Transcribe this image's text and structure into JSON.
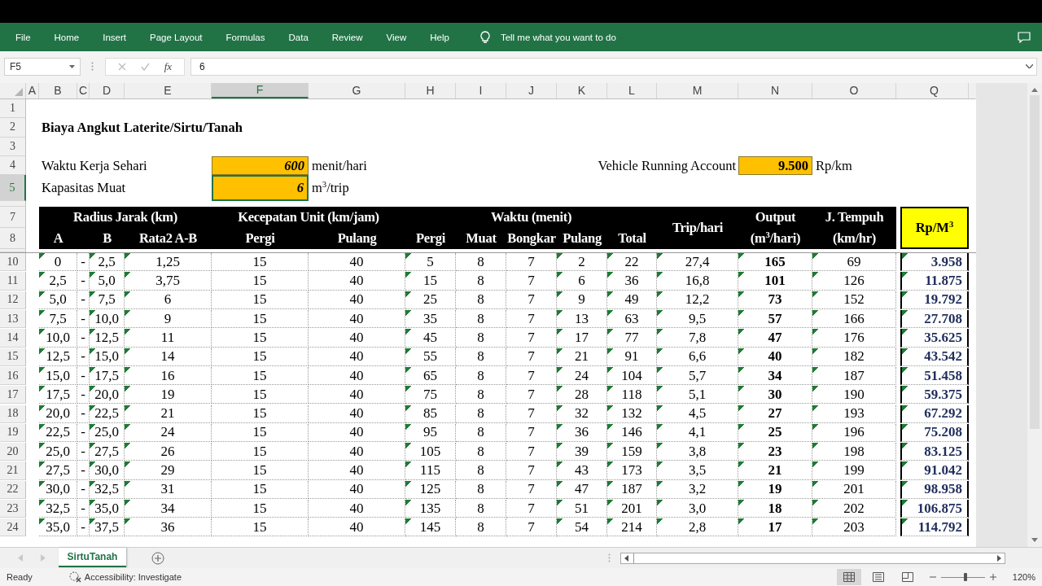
{
  "ribbon": {
    "tabs": [
      {
        "label": "File",
        "selected": false
      },
      {
        "label": "Home",
        "selected": false
      },
      {
        "label": "Insert",
        "selected": false
      },
      {
        "label": "Page Layout",
        "selected": false
      },
      {
        "label": "Formulas",
        "selected": false
      },
      {
        "label": "Data",
        "selected": false
      },
      {
        "label": "Review",
        "selected": false
      },
      {
        "label": "View",
        "selected": false
      },
      {
        "label": "Help",
        "selected": false
      }
    ],
    "tell_me": "Tell me what you want to do"
  },
  "formula_bar": {
    "name_box": "F5",
    "function_label": "fx",
    "formula": "6"
  },
  "column_headers": [
    {
      "label": "A",
      "selected": false
    },
    {
      "label": "B",
      "selected": false
    },
    {
      "label": "C",
      "selected": false
    },
    {
      "label": "D",
      "selected": false
    },
    {
      "label": "E",
      "selected": false
    },
    {
      "label": "F",
      "selected": true
    },
    {
      "label": "G",
      "selected": false
    },
    {
      "label": "H",
      "selected": false
    },
    {
      "label": "I",
      "selected": false
    },
    {
      "label": "J",
      "selected": false
    },
    {
      "label": "K",
      "selected": false
    },
    {
      "label": "L",
      "selected": false
    },
    {
      "label": "M",
      "selected": false
    },
    {
      "label": "N",
      "selected": false
    },
    {
      "label": "O",
      "selected": false
    },
    {
      "label": "Q",
      "selected": false
    }
  ],
  "top_row_numbers": [
    {
      "label": "1",
      "selected": false
    },
    {
      "label": "2",
      "selected": false
    },
    {
      "label": "3",
      "selected": false
    },
    {
      "label": "4",
      "selected": false
    },
    {
      "label": "5",
      "selected": true
    },
    {
      "label": "7",
      "selected": false
    },
    {
      "label": "8",
      "selected": false
    }
  ],
  "sheet": {
    "title": "Biaya Angkut Laterite/Sirtu/Tanah",
    "inputs": [
      {
        "label": "Waktu Kerja Sehari",
        "value": "600",
        "unit": "menit/hari",
        "selected": false
      },
      {
        "label": "Kapasitas Muat",
        "value": "6",
        "unit": "m$^{3}$/trip",
        "selected": true
      }
    ],
    "vehicle": {
      "label": "Vehicle Running Account",
      "value": "9.500",
      "unit": "Rp/km"
    },
    "header_row_1": [
      "Radius Jarak (km)",
      "Kecepatan Unit (km/jam)",
      "Waktu (menit)",
      "Trip/hari",
      "Output (m$^{3}$/hari)",
      "J. Tempuh (km/hr)"
    ],
    "header_row_2": [
      "A",
      "B",
      "Rata2 A-B",
      "Pergi",
      "Pulang",
      "Pergi",
      "Muat",
      "Bongkar",
      "Pulang",
      "Total"
    ],
    "price_header": "Rp/M$^{3}$",
    "rows": [
      {
        "row": "10",
        "selected": false,
        "cells": [
          "0",
          "-",
          "2,5",
          "1,25",
          "15",
          "40",
          "5",
          "8",
          "7",
          "2",
          "22",
          "27,4",
          "165",
          "69",
          "3.958"
        ]
      },
      {
        "row": "11",
        "selected": false,
        "cells": [
          "2,5",
          "-",
          "5,0",
          "3,75",
          "15",
          "40",
          "15",
          "8",
          "7",
          "6",
          "36",
          "16,8",
          "101",
          "126",
          "11.875"
        ]
      },
      {
        "row": "12",
        "selected": false,
        "cells": [
          "5,0",
          "-",
          "7,5",
          "6",
          "15",
          "40",
          "25",
          "8",
          "7",
          "9",
          "49",
          "12,2",
          "73",
          "152",
          "19.792"
        ]
      },
      {
        "row": "13",
        "selected": false,
        "cells": [
          "7,5",
          "-",
          "10,0",
          "9",
          "15",
          "40",
          "35",
          "8",
          "7",
          "13",
          "63",
          "9,5",
          "57",
          "166",
          "27.708"
        ]
      },
      {
        "row": "14",
        "selected": false,
        "cells": [
          "10,0",
          "-",
          "12,5",
          "11",
          "15",
          "40",
          "45",
          "8",
          "7",
          "17",
          "77",
          "7,8",
          "47",
          "176",
          "35.625"
        ]
      },
      {
        "row": "15",
        "selected": false,
        "cells": [
          "12,5",
          "-",
          "15,0",
          "14",
          "15",
          "40",
          "55",
          "8",
          "7",
          "21",
          "91",
          "6,6",
          "40",
          "182",
          "43.542"
        ]
      },
      {
        "row": "16",
        "selected": false,
        "cells": [
          "15,0",
          "-",
          "17,5",
          "16",
          "15",
          "40",
          "65",
          "8",
          "7",
          "24",
          "104",
          "5,7",
          "34",
          "187",
          "51.458"
        ]
      },
      {
        "row": "17",
        "selected": false,
        "cells": [
          "17,5",
          "-",
          "20,0",
          "19",
          "15",
          "40",
          "75",
          "8",
          "7",
          "28",
          "118",
          "5,1",
          "30",
          "190",
          "59.375"
        ]
      },
      {
        "row": "18",
        "selected": false,
        "cells": [
          "20,0",
          "-",
          "22,5",
          "21",
          "15",
          "40",
          "85",
          "8",
          "7",
          "32",
          "132",
          "4,5",
          "27",
          "193",
          "67.292"
        ]
      },
      {
        "row": "19",
        "selected": false,
        "cells": [
          "22,5",
          "-",
          "25,0",
          "24",
          "15",
          "40",
          "95",
          "8",
          "7",
          "36",
          "146",
          "4,1",
          "25",
          "196",
          "75.208"
        ]
      },
      {
        "row": "20",
        "selected": false,
        "cells": [
          "25,0",
          "-",
          "27,5",
          "26",
          "15",
          "40",
          "105",
          "8",
          "7",
          "39",
          "159",
          "3,8",
          "23",
          "198",
          "83.125"
        ]
      },
      {
        "row": "21",
        "selected": false,
        "cells": [
          "27,5",
          "-",
          "30,0",
          "29",
          "15",
          "40",
          "115",
          "8",
          "7",
          "43",
          "173",
          "3,5",
          "21",
          "199",
          "91.042"
        ]
      },
      {
        "row": "22",
        "selected": false,
        "cells": [
          "30,0",
          "-",
          "32,5",
          "31",
          "15",
          "40",
          "125",
          "8",
          "7",
          "47",
          "187",
          "3,2",
          "19",
          "201",
          "98.958"
        ]
      },
      {
        "row": "23",
        "selected": false,
        "cells": [
          "32,5",
          "-",
          "35,0",
          "34",
          "15",
          "40",
          "135",
          "8",
          "7",
          "51",
          "201",
          "3,0",
          "18",
          "202",
          "106.875"
        ]
      },
      {
        "row": "24",
        "selected": false,
        "cells": [
          "35,0",
          "-",
          "37,5",
          "36",
          "15",
          "40",
          "145",
          "8",
          "7",
          "54",
          "214",
          "2,8",
          "17",
          "203",
          "114.792"
        ]
      }
    ]
  },
  "sheet_tabs": [
    {
      "label": "SirtuTanah",
      "selected": true
    }
  ],
  "status_bar": {
    "status": "Ready",
    "accessibility": "Accessibility: Investigate",
    "view_buttons": [
      {
        "kind": "normal",
        "selected": true
      },
      {
        "kind": "page_layout",
        "selected": false
      },
      {
        "kind": "page_break",
        "selected": false
      }
    ],
    "zoom": {
      "level": 0.55,
      "label": "120%"
    }
  }
}
